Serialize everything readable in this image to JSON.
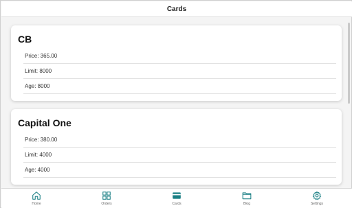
{
  "header": {
    "title": "Cards"
  },
  "cards": [
    {
      "name": "CB",
      "rows": [
        "Price: 365.00",
        "Limit: 8000",
        "Age: 8000"
      ]
    },
    {
      "name": "Capital One",
      "rows": [
        "Price: 380.00",
        "Limit: 4000",
        "Age: 4000"
      ]
    }
  ],
  "tabs": [
    {
      "label": "Home",
      "icon": "home-icon"
    },
    {
      "label": "Orders",
      "icon": "grid-icon"
    },
    {
      "label": "Cards",
      "icon": "credit-card-icon",
      "active": true
    },
    {
      "label": "Blog",
      "icon": "folder-icon"
    },
    {
      "label": "Settings",
      "icon": "gear-icon"
    }
  ],
  "colors": {
    "accent": "#1a7f84",
    "header_bg": "#ffffff",
    "page_bg": "#f4f4f4"
  }
}
